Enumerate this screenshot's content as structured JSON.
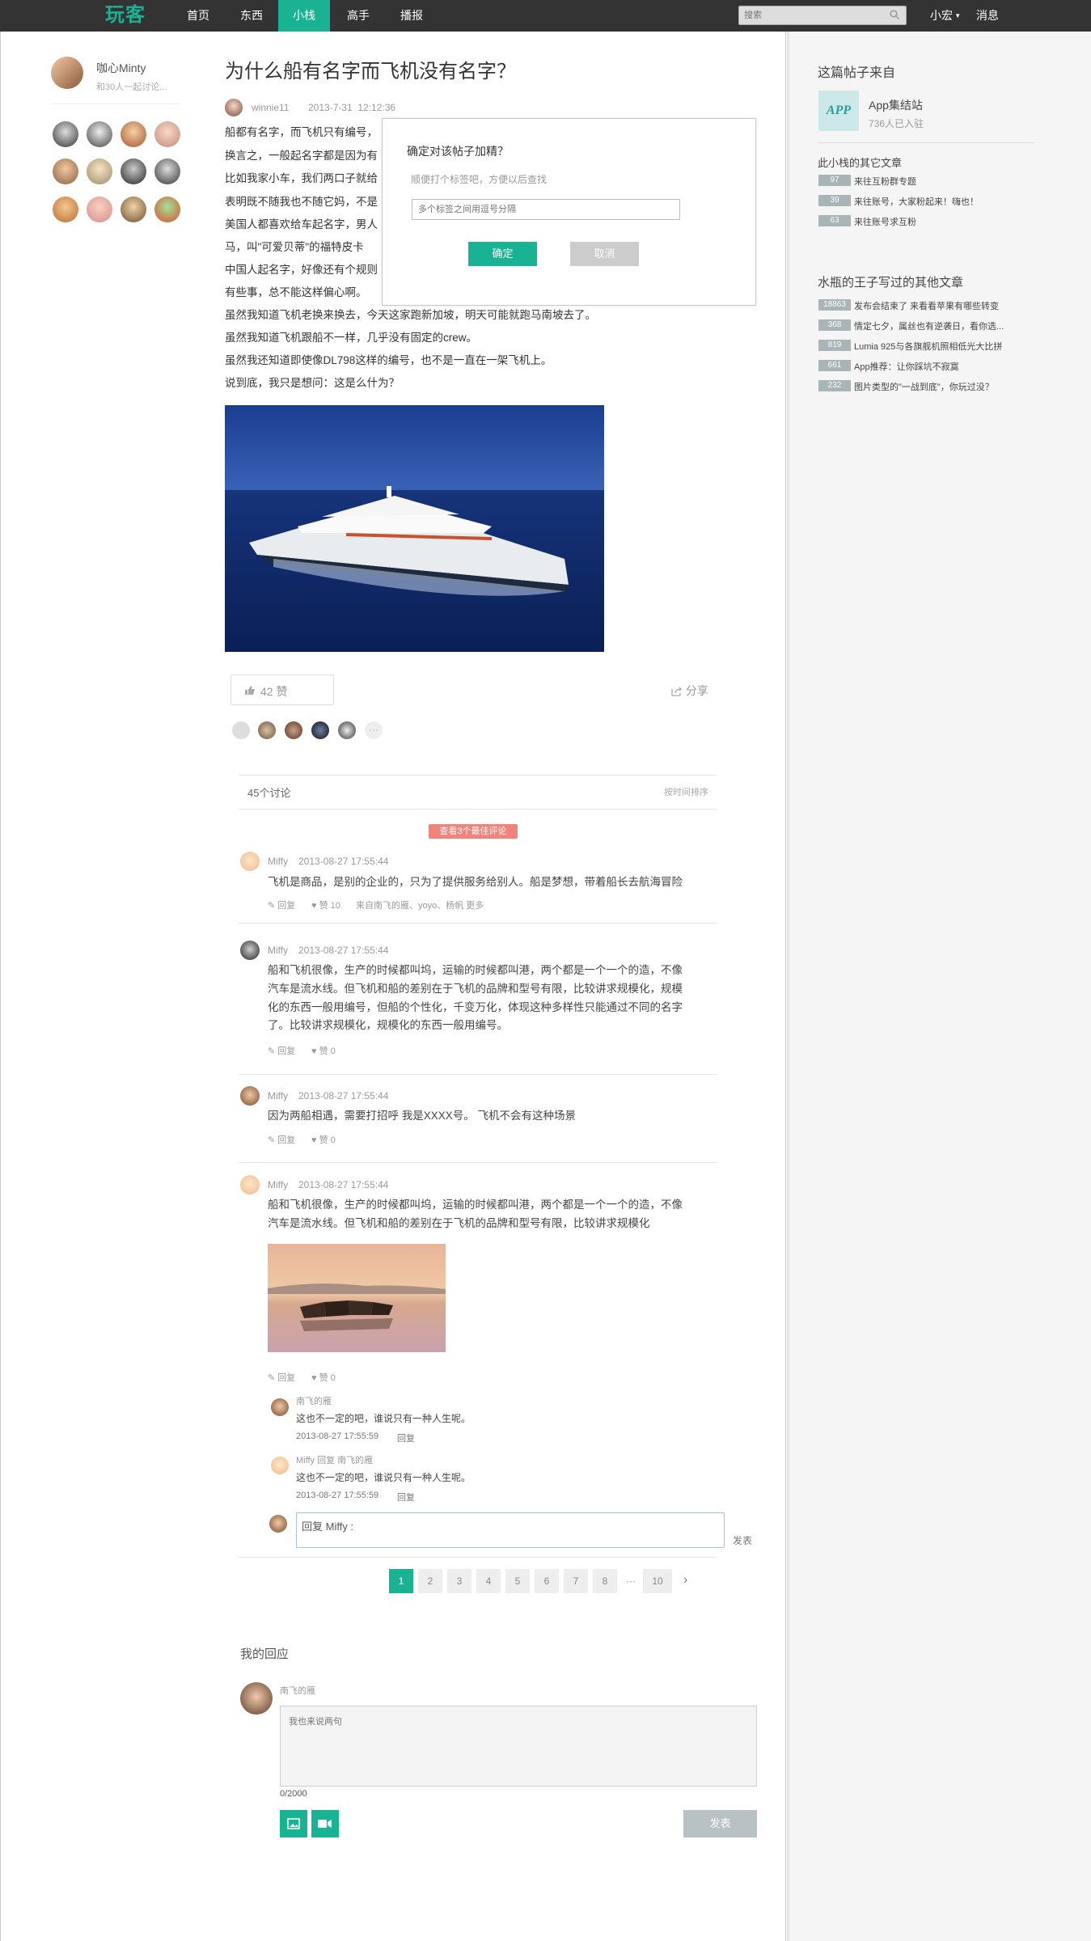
{
  "nav": {
    "logo": "玩客",
    "items": [
      "首页",
      "东西",
      "小栈",
      "高手",
      "播报"
    ],
    "search_placeholder": "搜索",
    "user": "小宏",
    "messages": "消息"
  },
  "left": {
    "owner_name": "咖心Minty",
    "owner_sub": "和30人一起讨论..."
  },
  "post": {
    "title": "为什么船有名字而飞机没有名字？",
    "author": "winnie11",
    "date": "2013-7-31  12:12:36",
    "lines": [
      "船都有名字，而飞机只有编号，",
      "换言之，一般起名字都是因为有",
      "比如我家小车，我们两口子就给",
      "表明既不随我也不随它妈，不是",
      "美国人都喜欢给车起名字，男人",
      "马，叫\"可爱贝蒂\"的福特皮卡",
      "中国人起名字，好像还有个规则",
      "有些事，总不能这样偏心啊。",
      "虽然我知道飞机老换来换去，今天这家跑新加坡，明天可能就跑马南坡去了。",
      "虽然我知道飞机跟船不一样，几乎没有固定的crew。",
      "虽然我还知道即使像DL798这样的编号，也不是一直在一架飞机上。",
      "说到底，我只是想问：这是么什为？"
    ],
    "like_label": "42 赞",
    "share_label": "分享"
  },
  "modal": {
    "title": "确定对该帖子加精？",
    "subtitle": "顺便打个标签吧，方便以后查找",
    "input_placeholder": "多个标签之间用逗号分隔",
    "confirm": "确定",
    "cancel": "取消"
  },
  "comments_header": {
    "count": "45个讨论",
    "sort": "按时间排序",
    "best": "查看3个最佳评论"
  },
  "comments": [
    {
      "user": "Miffy",
      "time": "2013-08-27 17:55:44",
      "lines": [
        "飞机是商品，是别的企业的，只为了提供服务给别人。船是梦想，带着船长去航海冒险"
      ],
      "reply": "回复",
      "likes": "赞 10",
      "likers": "来自南飞的雁、yoyo、杨帆  更多"
    },
    {
      "user": "Miffy",
      "time": "2013-08-27 17:55:44",
      "lines": [
        "船和飞机很像，生产的时候都叫坞，运输的时候都叫港，两个都是一个一个的造，不像",
        "汽车是流水线。但飞机和船的差别在于飞机的品牌和型号有限，比较讲求规模化，规模",
        "化的东西一般用编号，但船的个性化，千变万化，体现这种多样性只能通过不同的名字",
        "了。比较讲求规模化，规模化的东西一般用编号。"
      ],
      "reply": "回复",
      "likes": "赞 0"
    },
    {
      "user": "Miffy",
      "time": "2013-08-27 17:55:44",
      "lines": [
        "因为两船相遇，需要打招呼 我是XXXX号。 飞机不会有这种场景"
      ],
      "reply": "回复",
      "likes": "赞 0"
    },
    {
      "user": "Miffy",
      "time": "2013-08-27 17:55:44",
      "lines": [
        "船和飞机很像，生产的时候都叫坞，运输的时候都叫港，两个都是一个一个的造，不像",
        "汽车是流水线。但飞机和船的差别在于飞机的品牌和型号有限，比较讲求规模化"
      ],
      "reply": "回复",
      "likes": "赞 0"
    }
  ],
  "subreplies": [
    {
      "user": "南飞的雁",
      "text": "这也不一定的吧，谁说只有一种人生呢。",
      "time": "2013-08-27 17:55:59",
      "reply": "回复"
    },
    {
      "user": "Miffy 回复 南飞的雁",
      "text": "这也不一定的吧，谁说只有一种人生呢。",
      "time": "2013-08-27 17:55:59",
      "reply": "回复"
    }
  ],
  "reply_box": {
    "value": "回复 Miffy :",
    "submit": "发表"
  },
  "pagination": [
    "1",
    "2",
    "3",
    "4",
    "5",
    "6",
    "7",
    "8",
    "···",
    "10"
  ],
  "my_reply": {
    "title": "我的回应",
    "user": "南飞的雁",
    "placeholder": "我也来说两句",
    "counter": "0/2000",
    "submit": "发表"
  },
  "sidebar": {
    "from_title": "这篇帖子来自",
    "group_logo": "APP",
    "group_name": "App集结站",
    "group_count": "736人已入驻",
    "other_title": "此小栈的其它文章",
    "other_items": [
      {
        "count": "97",
        "title": "来往互粉群专题"
      },
      {
        "count": "39",
        "title": "来往账号，大家粉起来！嗨也！"
      },
      {
        "count": "63",
        "title": "来往账号求互粉"
      }
    ],
    "author_title": "水瓶的王子写过的其他文章",
    "author_items": [
      {
        "count": "18863",
        "title": "发布会结束了 来看看苹果有哪些转变"
      },
      {
        "count": "368",
        "title": "情定七夕，属丝也有逆袭日，看你选..."
      },
      {
        "count": "819",
        "title": "Lumia 925与各旗舰机照相低光大比拼"
      },
      {
        "count": "661",
        "title": "App推荐：让你踩坑不寂寞"
      },
      {
        "count": "232",
        "title": "图片类型的\"一战到底\"，你玩过没？"
      }
    ]
  },
  "colors": {
    "accent": "#19b394",
    "topbar": "#333333",
    "best_badge": "#f0837c"
  }
}
